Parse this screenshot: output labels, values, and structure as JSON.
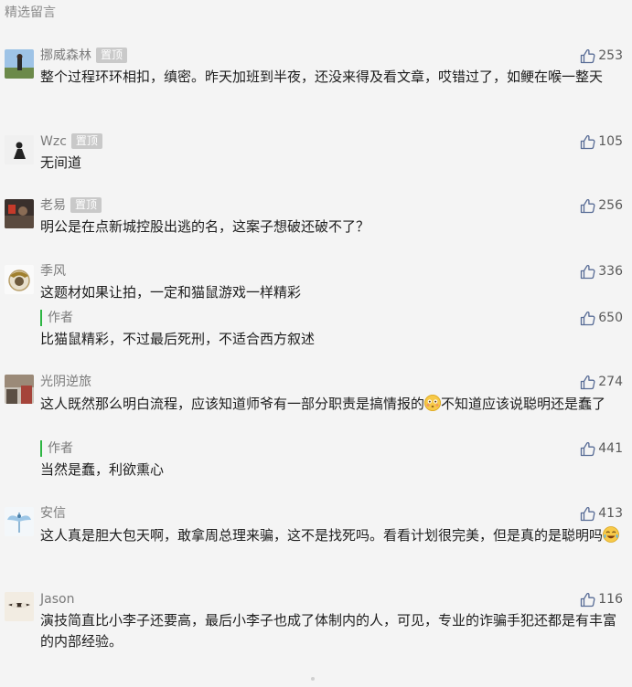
{
  "section_title": "精选留言",
  "pin_label": "置顶",
  "author_label": "作者",
  "colors": {
    "background": "#f4f4f4",
    "nickname": "#7b7b7b",
    "author_bar": "#2db543",
    "pin_badge": "#c9c9c9"
  },
  "comments": [
    {
      "nick": "挪威森林",
      "pinned": true,
      "likes": "253",
      "text": "整个过程环环相扣，缜密。昨天加班到半夜，还没来得及看文章，哎错过了，如鲠在喉一整天"
    },
    {
      "nick": "Wzc",
      "pinned": true,
      "likes": "105",
      "text": "无间道"
    },
    {
      "nick": "老易",
      "pinned": true,
      "likes": "256",
      "text": "明公是在点新城控股出逃的名，这案子想破还破不了？"
    },
    {
      "nick": "季风",
      "pinned": false,
      "likes": "336",
      "text": "这题材如果让拍，一定和猫鼠游戏一样精彩",
      "reply": {
        "likes": "650",
        "text": "比猫鼠精彩，不过最后死刑，不适合西方叙述"
      }
    },
    {
      "nick": "光阴逆旅",
      "pinned": false,
      "likes": "274",
      "text_a": "这人既然那么明白流程，应该知道师爷有一部分职责是搞情报的",
      "emoji": "flushed-emoji",
      "text_b": "不知道应该说聪明还是蠢了",
      "reply": {
        "likes": "441",
        "text": "当然是蠢，利欲熏心"
      }
    },
    {
      "nick": "安信",
      "pinned": false,
      "likes": "413",
      "text_a": "这人真是胆大包天啊，敢拿周总理来骗，这不是找死吗。看看计划很完美，但是真的是聪明吗",
      "emoji": "tears-of-joy-emoji"
    },
    {
      "nick": "Jason",
      "pinned": false,
      "likes": "116",
      "text": "演技简直比小李子还要高，最后小李子也成了体制内的人，可见，专业的诈骗手犯还都是有丰富的内部经验。"
    }
  ]
}
